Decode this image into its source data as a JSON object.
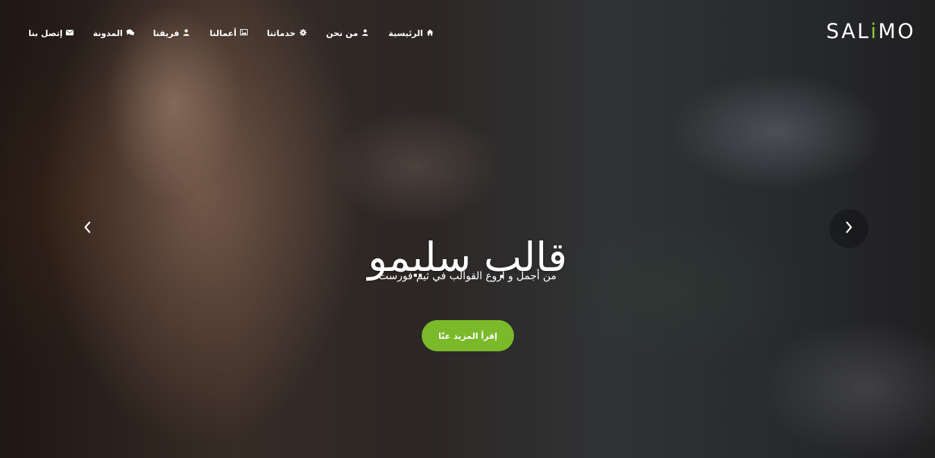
{
  "header": {
    "logo_pre": "SAL",
    "logo_accent": "i",
    "logo_post": "MO",
    "nav": [
      {
        "label": "الرئيسية",
        "icon": "home-icon"
      },
      {
        "label": "من نحن",
        "icon": "user-icon"
      },
      {
        "label": "خدماتنا",
        "icon": "gear-icon"
      },
      {
        "label": "أعمالنا",
        "icon": "image-icon"
      },
      {
        "label": "فريقنا",
        "icon": "user-icon"
      },
      {
        "label": "المدونة",
        "icon": "comments-icon"
      },
      {
        "label": "إتصل بنا",
        "icon": "envelope-icon"
      }
    ]
  },
  "slide": {
    "title": "قالب سليمو",
    "subtitle": "من أجمل و أروع القوالب في ثيم فورست",
    "cta_label": "إقرأ المزيد عنّا"
  },
  "colors": {
    "accent": "#7ab929",
    "logo_accent": "#8ccf3a",
    "text": "#ffffff"
  }
}
